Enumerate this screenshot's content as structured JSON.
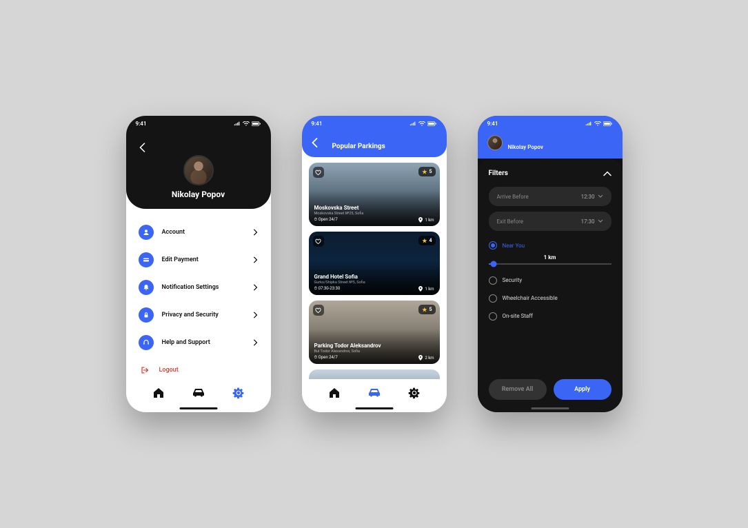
{
  "status": {
    "time": "9:41"
  },
  "profile": {
    "name": "Nikolay Popov",
    "menu": [
      {
        "label": "Account"
      },
      {
        "label": "Edit Payment"
      },
      {
        "label": "Notification Settings"
      },
      {
        "label": "Privacy and Security"
      },
      {
        "label": "Help and Support"
      },
      {
        "label": "Logout"
      }
    ]
  },
  "popular": {
    "title": "Popular Parkings",
    "cards": [
      {
        "name": "Moskovska Street",
        "addr": "Moskovska Street №25, Sofia",
        "hours": "Open 24/7",
        "dist": "1 km",
        "rating": "5"
      },
      {
        "name": "Grand Hotel Sofia",
        "addr": "Gurko/Shipka Street №5, Sofia",
        "hours": "07:30-23:30",
        "dist": "1 km",
        "rating": "4"
      },
      {
        "name": "Parking Todor Aleksandrov",
        "addr": "Bul Todor Alexandrov, Sofia",
        "hours": "Open 24/7",
        "dist": "2 km",
        "rating": "5"
      }
    ]
  },
  "filters": {
    "user": "Nikolay Popov",
    "title": "Filters",
    "arrive": {
      "label": "Arrive Before",
      "value": "12:30"
    },
    "exit": {
      "label": "Exit Before",
      "value": "17:30"
    },
    "near_label": "Near You",
    "slider_value": "1 km",
    "options": [
      {
        "label": "Security"
      },
      {
        "label": "Wheelchair Accessible"
      },
      {
        "label": "On-site Staff"
      }
    ],
    "remove_label": "Remove All",
    "apply_label": "Apply"
  }
}
